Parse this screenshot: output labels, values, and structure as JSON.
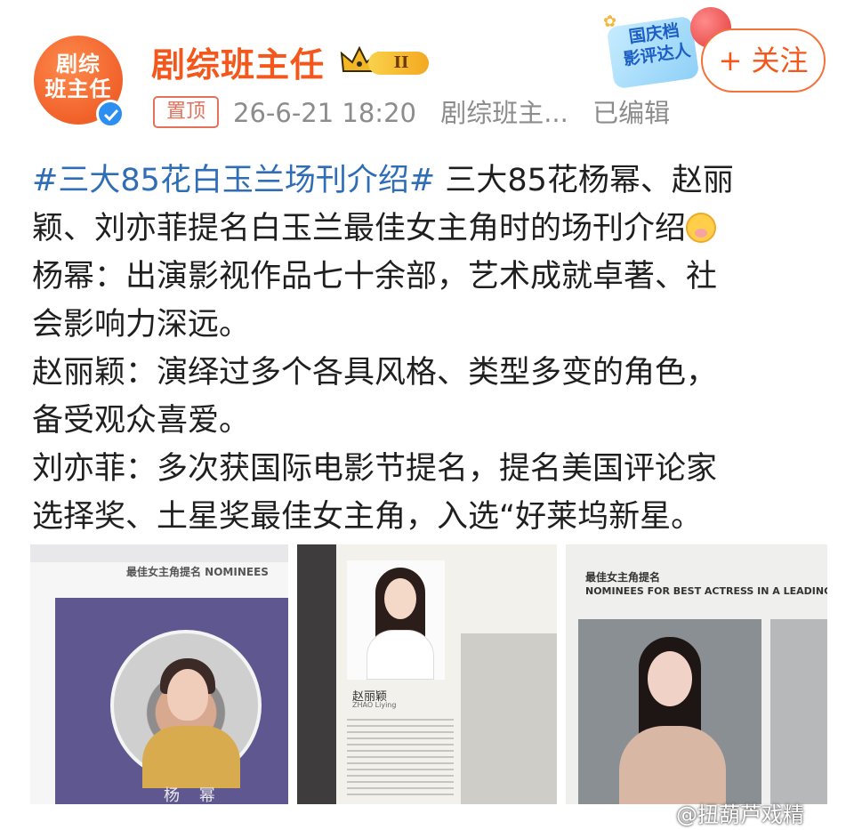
{
  "header": {
    "username": "剧综班主任",
    "avatar_text": "剧综\n班主任",
    "level": "II",
    "pin_tag": "置顶",
    "date": "26-6-21 18:20",
    "source": "剧综班主...",
    "edited": "已编辑",
    "event_badge": "国庆档\n影评达人",
    "follow_label": "+ 关注"
  },
  "post": {
    "hashtag": "#三大85花白玉兰场刊介绍#",
    "lines": [
      "三大85花杨幂、赵丽",
      "颖、刘亦菲提名白玉兰最佳女主角时的场刊介绍",
      "杨幂：出演影视作品七十余部，艺术成就卓著、社",
      "会影响力深远。",
      "赵丽颖：演绎过多个各具风格、类型多变的角色，",
      "备受观众喜爱。",
      "刘亦菲：多次获国际电影节提名，提名美国评论家",
      "选择奖、土星奖最佳女主角，入选“好莱坞新星。"
    ]
  },
  "images": {
    "img1": {
      "heading": "最佳女主角提名   NOMINEES",
      "name": "杨 幂"
    },
    "img2": {
      "name": "赵丽颖",
      "pinyin": "ZHAO Liying"
    },
    "img3": {
      "heading": "最佳女主角提名",
      "heading_en": "NOMINEES FOR BEST ACTRESS IN A LEADING ROLE"
    }
  },
  "watermark": "@扭葫芦戏精",
  "colors": {
    "brand": "#f4571c",
    "hashtag": "#2f6eb6",
    "meta": "#8c8c8c"
  }
}
